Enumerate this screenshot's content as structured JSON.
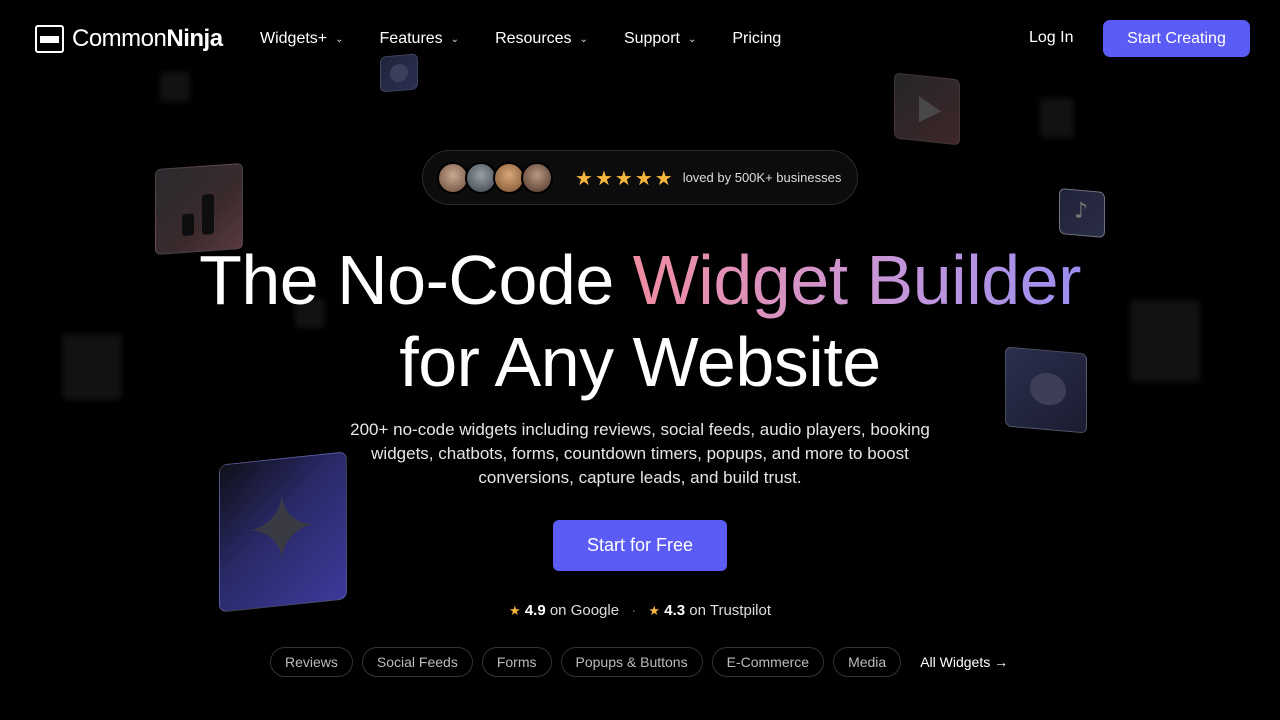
{
  "brand": {
    "name_light": "Common",
    "name_bold": "Ninja"
  },
  "nav": {
    "items": [
      {
        "label": "Widgets+",
        "dropdown": true
      },
      {
        "label": "Features",
        "dropdown": true
      },
      {
        "label": "Resources",
        "dropdown": true
      },
      {
        "label": "Support",
        "dropdown": true
      },
      {
        "label": "Pricing",
        "dropdown": false
      }
    ],
    "login": "Log In",
    "cta": "Start Creating"
  },
  "social_proof": {
    "star_count": 5,
    "text": "loved by 500K+ businesses"
  },
  "hero": {
    "title_line1_plain": "The No-Code ",
    "title_line1_highlight": "Widget Builder",
    "title_line2": "for Any Website",
    "subtitle": "200+ no-code widgets including reviews, social feeds, audio players, booking widgets, chatbots, forms, countdown timers, popups, and more to boost conversions, capture leads, and build trust.",
    "primary_button": "Start for Free"
  },
  "ratings": {
    "google": {
      "score": "4.9",
      "label": "on Google"
    },
    "trustpilot": {
      "score": "4.3",
      "label": "on Trustpilot"
    },
    "separator": "·"
  },
  "categories": [
    "Reviews",
    "Social Feeds",
    "Forms",
    "Popups & Buttons",
    "E-Commerce",
    "Media"
  ],
  "all_widgets": "All Widgets →",
  "colors": {
    "accent": "#5b5bf5",
    "star": "#f6b53c",
    "gradient": [
      "#f08ca0",
      "#c896d6",
      "#9b8ef0"
    ]
  },
  "icons": {
    "music": "♪",
    "star_shape": "✦",
    "star": "★",
    "chevron": "⌄"
  }
}
